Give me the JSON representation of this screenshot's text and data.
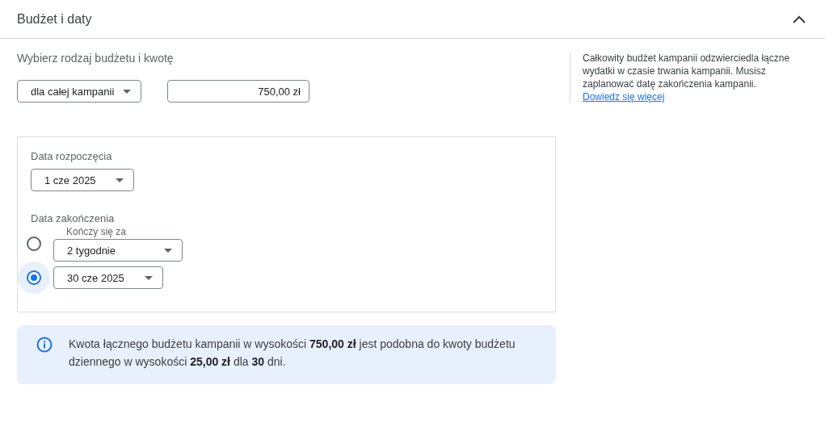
{
  "header": {
    "title": "Budżet i daty",
    "expanded": true
  },
  "budget": {
    "label": "Wybierz rodzaj budżetu i kwotę",
    "type_dropdown": "dla całej kampanii",
    "amount": "750,00 zł"
  },
  "dates": {
    "start_label": "Data rozpoczęcia",
    "start_value": "1 cze 2025",
    "end_label": "Data zakończenia",
    "end_options": [
      {
        "floating_label": "Kończy się za",
        "value": "2 tygodnie",
        "selected": false
      },
      {
        "value": "30 cze 2025",
        "selected": true
      }
    ]
  },
  "info": {
    "text": "Kwota łącznego budżetu kampanii w wysokości **750,00 zł** jest podobna do kwoty budżetu dziennego w wysokości **25,00 zł** dla **30** dni."
  },
  "help": {
    "text": "Całkowity budżet kampanii odzwierciedla łączne wydatki w czasie trwania kampanii. Musisz zaplanować datę zakończenia kampanii.",
    "link": "Dowiedz się więcej"
  }
}
